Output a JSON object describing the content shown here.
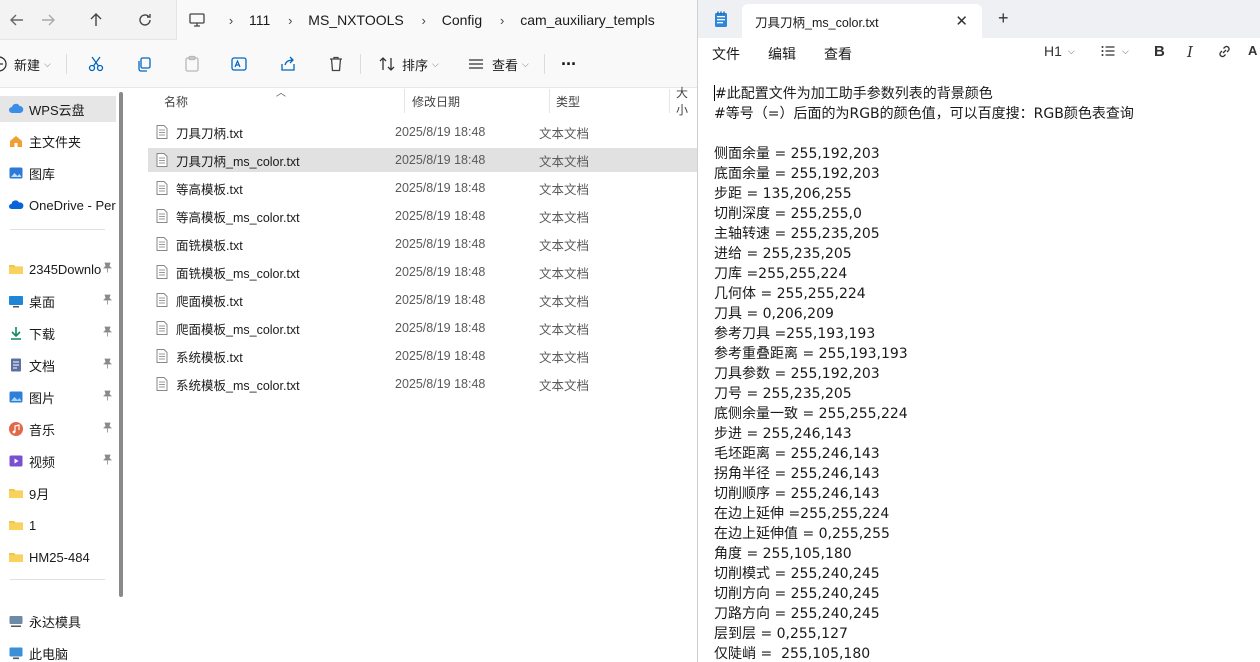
{
  "explorer": {
    "breadcrumb": [
      "111",
      "MS_NXTOOLS",
      "Config",
      "cam_auxiliary_templs"
    ],
    "toolbar": {
      "new_label": "新建",
      "sort_label": "排序",
      "view_label": "查看",
      "more_label": "···"
    },
    "sidebar": [
      {
        "label": "WPS云盘",
        "icon": "wps-cloud-icon",
        "pinned": false
      },
      {
        "label": "主文件夹",
        "icon": "home-icon",
        "pinned": false
      },
      {
        "label": "图库",
        "icon": "gallery-icon",
        "pinned": false
      },
      {
        "label": "OneDrive - Per",
        "icon": "onedrive-icon",
        "pinned": false
      },
      {
        "label": "2345Downlo",
        "icon": "folder-icon",
        "pinned": true
      },
      {
        "label": "桌面",
        "icon": "desktop-icon",
        "pinned": true
      },
      {
        "label": "下载",
        "icon": "download-icon",
        "pinned": true
      },
      {
        "label": "文档",
        "icon": "documents-icon",
        "pinned": true
      },
      {
        "label": "图片",
        "icon": "pictures-icon",
        "pinned": true
      },
      {
        "label": "音乐",
        "icon": "music-icon",
        "pinned": true
      },
      {
        "label": "视频",
        "icon": "videos-icon",
        "pinned": true
      },
      {
        "label": "9月",
        "icon": "folder-icon",
        "pinned": false
      },
      {
        "label": "1",
        "icon": "folder-icon",
        "pinned": false
      },
      {
        "label": "HM25-484",
        "icon": "folder-icon",
        "pinned": false
      },
      {
        "label": "永达模具",
        "icon": "network-drive-icon",
        "pinned": false
      },
      {
        "label": "此电脑",
        "icon": "this-pc-icon",
        "pinned": false
      }
    ],
    "columns": {
      "name": "名称",
      "modified": "修改日期",
      "type": "类型",
      "size": "大小"
    },
    "files": [
      {
        "name": "刀具刀柄.txt",
        "modified": "2025/8/19 18:48",
        "type": "文本文档"
      },
      {
        "name": "刀具刀柄_ms_color.txt",
        "modified": "2025/8/19 18:48",
        "type": "文本文档"
      },
      {
        "name": "等高模板.txt",
        "modified": "2025/8/19 18:48",
        "type": "文本文档"
      },
      {
        "name": "等高模板_ms_color.txt",
        "modified": "2025/8/19 18:48",
        "type": "文本文档"
      },
      {
        "name": "面铣模板.txt",
        "modified": "2025/8/19 18:48",
        "type": "文本文档"
      },
      {
        "name": "面铣模板_ms_color.txt",
        "modified": "2025/8/19 18:48",
        "type": "文本文档"
      },
      {
        "name": "爬面模板.txt",
        "modified": "2025/8/19 18:48",
        "type": "文本文档"
      },
      {
        "name": "爬面模板_ms_color.txt",
        "modified": "2025/8/19 18:48",
        "type": "文本文档"
      },
      {
        "name": "系统模板.txt",
        "modified": "2025/8/19 18:48",
        "type": "文本文档"
      },
      {
        "name": "系统模板_ms_color.txt",
        "modified": "2025/8/19 18:48",
        "type": "文本文档"
      }
    ]
  },
  "notepad": {
    "tab_title": "刀具刀柄_ms_color.txt",
    "menu": {
      "file": "文件",
      "edit": "编辑",
      "view": "查看",
      "heading": "H1"
    },
    "lines": [
      "#此配置文件为加工助手参数列表的背景颜色",
      "#等号（=）后面的为RGB的颜色值，可以百度搜：RGB颜色表查询",
      "",
      "侧面余量 = 255,192,203",
      "底面余量 = 255,192,203",
      "步距 = 135,206,255",
      "切削深度 = 255,255,0",
      "主轴转速 = 255,235,205",
      "进给 = 255,235,205",
      "刀库 =255,255,224",
      "几何体 = 255,255,224",
      "刀具 = 0,206,209",
      "参考刀具 =255,193,193",
      "参考重叠距离 = 255,193,193",
      "刀具参数 = 255,192,203",
      "刀号 = 255,235,205",
      "底侧余量一致 = 255,255,224",
      "步进 = 255,246,143",
      "毛坯距离 = 255,246,143",
      "拐角半径 = 255,246,143",
      "切削顺序 = 255,246,143",
      "在边上延伸 =255,255,224",
      "在边上延伸值 = 0,255,255",
      "角度 = 255,105,180",
      "切削模式 = 255,240,245",
      "切削方向 = 255,240,245",
      "刀路方向 = 255,240,245",
      "层到层 = 0,255,127",
      "仅陡峭 =  255,105,180"
    ]
  },
  "colors": {
    "selection": "#e1e1e1",
    "folder": "#f4c542",
    "accent": "#0067c0"
  }
}
